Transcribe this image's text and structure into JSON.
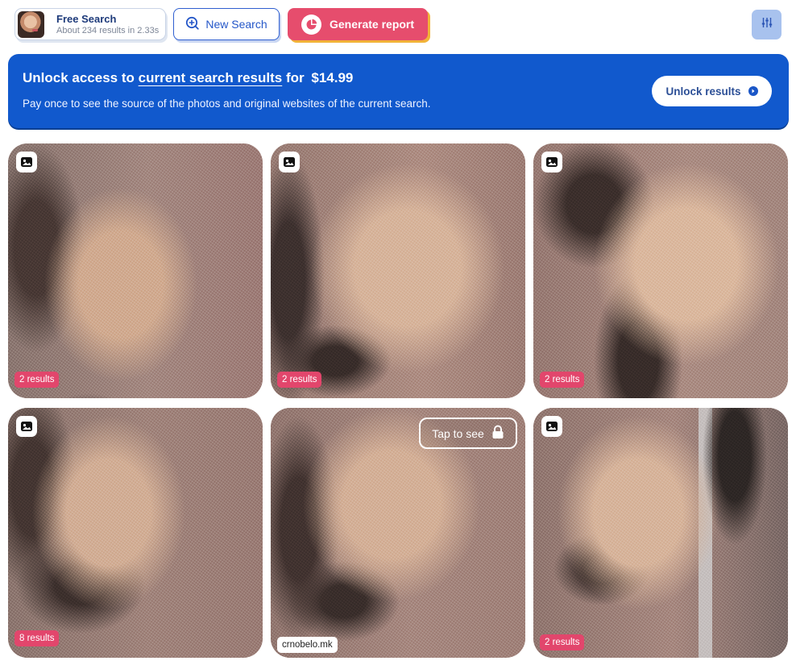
{
  "search": {
    "title": "Free Search",
    "subtitle": "About 234 results in 2.33s"
  },
  "toolbar": {
    "new_search_label": "New Search",
    "generate_report_label": "Generate report"
  },
  "banner": {
    "title_prefix": "Unlock access to",
    "title_link": "current search results",
    "title_for": "for",
    "price": "$14.99",
    "subtitle": "Pay once to see the source of the photos and original websites of the current search.",
    "button_label": "Unlock results"
  },
  "results": [
    {
      "badge": "2 results"
    },
    {
      "badge": "2 results"
    },
    {
      "badge": "2 results"
    },
    {
      "badge": "8 results"
    },
    {
      "site": "crnobelo.mk",
      "tap_label": "Tap to see"
    },
    {
      "badge": "2 results"
    }
  ],
  "colors": {
    "brand_blue": "#1159cd",
    "accent_pink": "#e64d6d",
    "accent_yellow": "#f1b338"
  },
  "icons": {
    "new_search": "magnifier-plus-icon",
    "generate_report": "pie-chart-icon",
    "filter": "sliders-icon",
    "image_type": "image-icon",
    "lock": "lock-icon",
    "unlock_arrow": "arrow-circle-icon"
  }
}
